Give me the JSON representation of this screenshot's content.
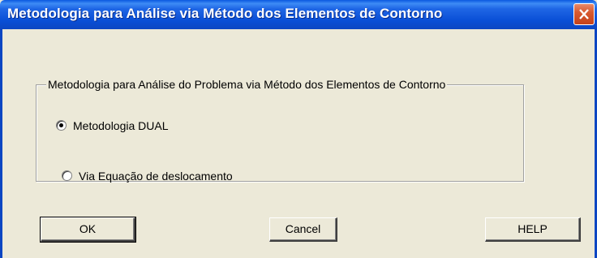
{
  "window": {
    "title": "Metodologia para Análise via Método dos Elementos de Contorno"
  },
  "group": {
    "legend": "Metodologia para Análise do Problema via Método dos Elementos de Contorno"
  },
  "options": [
    {
      "label": "Metodologia DUAL",
      "selected": true
    },
    {
      "label": "Via Equação de deslocamento",
      "selected": false
    }
  ],
  "buttons": {
    "ok": "OK",
    "cancel": "Cancel",
    "help": "HELP"
  },
  "colors": {
    "titlebar": "#0a4fd6",
    "dialog_bg": "#ece9d8",
    "close_button": "#d85a30"
  }
}
